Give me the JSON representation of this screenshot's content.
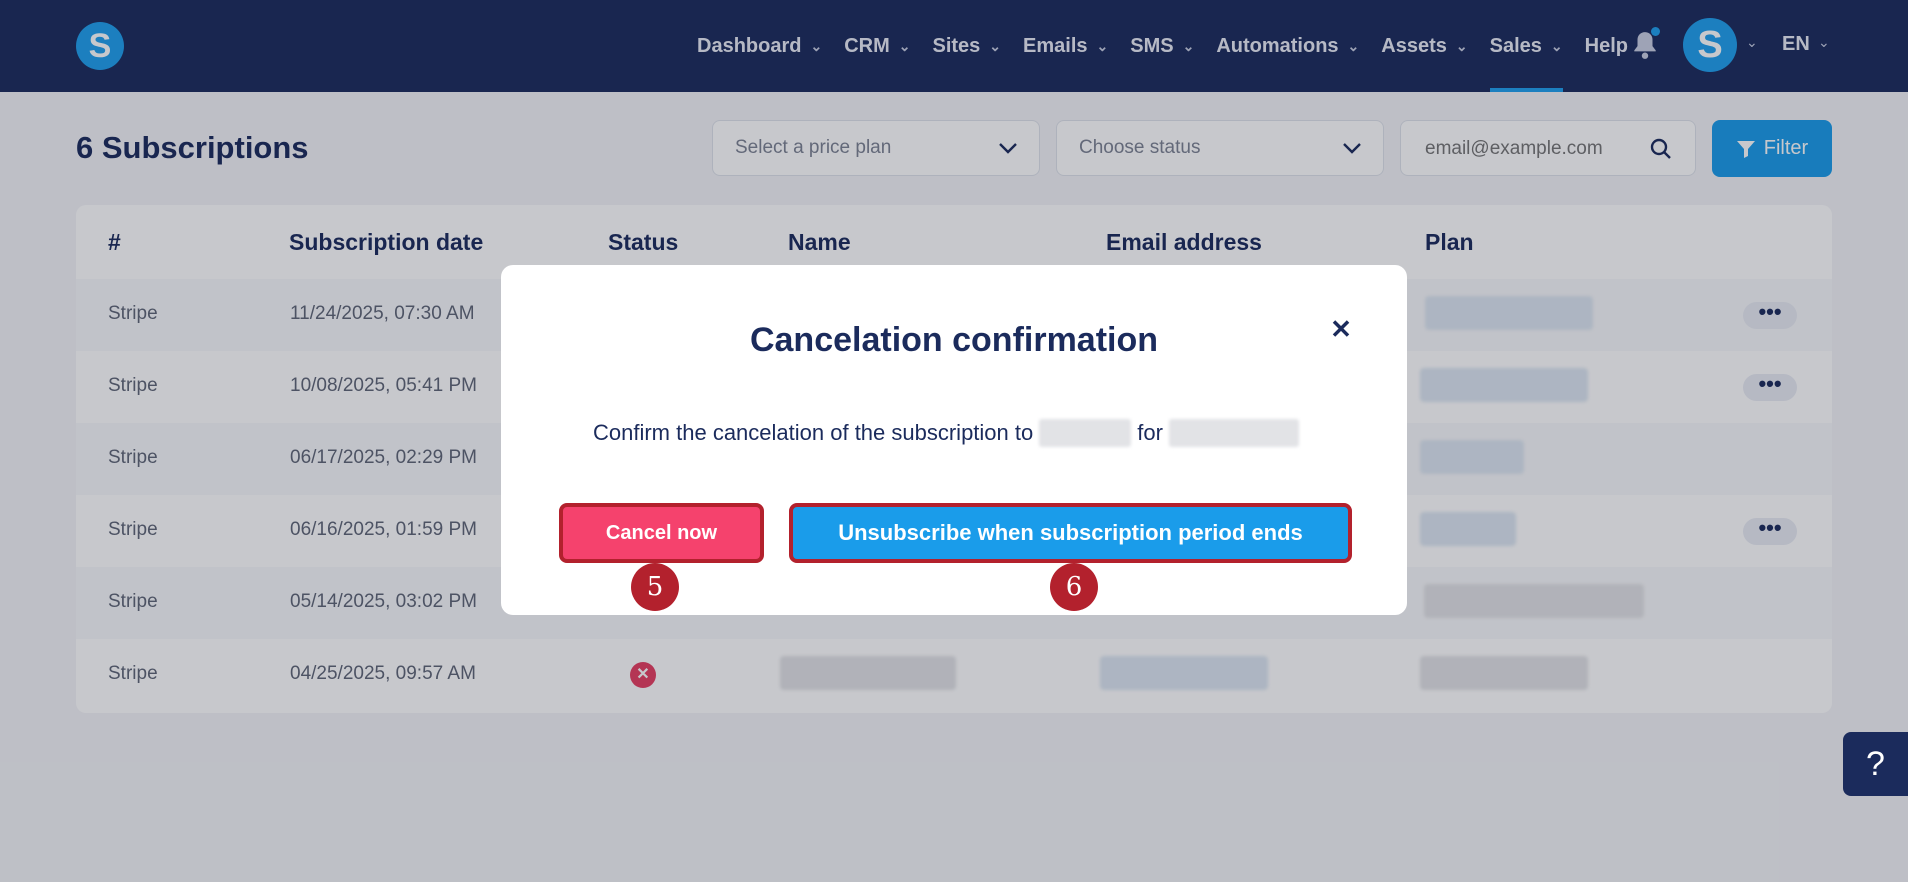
{
  "brand": {
    "logo_letter": "S"
  },
  "nav": {
    "items": [
      {
        "label": "Dashboard",
        "has_dropdown": true
      },
      {
        "label": "CRM",
        "has_dropdown": true
      },
      {
        "label": "Sites",
        "has_dropdown": true
      },
      {
        "label": "Emails",
        "has_dropdown": true
      },
      {
        "label": "SMS",
        "has_dropdown": true
      },
      {
        "label": "Automations",
        "has_dropdown": true
      },
      {
        "label": "Assets",
        "has_dropdown": true
      },
      {
        "label": "Sales",
        "has_dropdown": true,
        "active": true
      },
      {
        "label": "Help",
        "has_dropdown": false
      }
    ],
    "avatar_letter": "S",
    "language": "EN"
  },
  "page": {
    "title": "6 Subscriptions",
    "price_plan_placeholder": "Select a price plan",
    "status_placeholder": "Choose status",
    "email_placeholder": "email@example.com",
    "filter_label": "Filter"
  },
  "table": {
    "headers": [
      "#",
      "Subscription date",
      "Status",
      "Name",
      "Email address",
      "Plan"
    ],
    "rows": [
      {
        "source": "Stripe",
        "date": "11/24/2025, 07:30 AM",
        "has_menu": true
      },
      {
        "source": "Stripe",
        "date": "10/08/2025, 05:41 PM",
        "has_menu": true
      },
      {
        "source": "Stripe",
        "date": "06/17/2025, 02:29 PM",
        "has_menu": false
      },
      {
        "source": "Stripe",
        "date": "06/16/2025, 01:59 PM",
        "has_menu": true
      },
      {
        "source": "Stripe",
        "date": "05/14/2025, 03:02 PM",
        "has_menu": false
      },
      {
        "source": "Stripe",
        "date": "04/25/2025, 09:57 AM",
        "has_menu": false,
        "status": "canceled"
      }
    ]
  },
  "modal": {
    "title": "Cancelation confirmation",
    "text_prefix": "Confirm the cancelation of the subscription to",
    "text_middle": "for",
    "cancel_now_label": "Cancel now",
    "unsubscribe_label": "Unsubscribe when subscription period ends",
    "markers": [
      "5",
      "6"
    ]
  },
  "help": {
    "label": "?"
  },
  "colors": {
    "navbar": "#1b2b5c",
    "accent": "#1a9cea",
    "danger": "#f5426d",
    "marker": "#b3212d"
  }
}
